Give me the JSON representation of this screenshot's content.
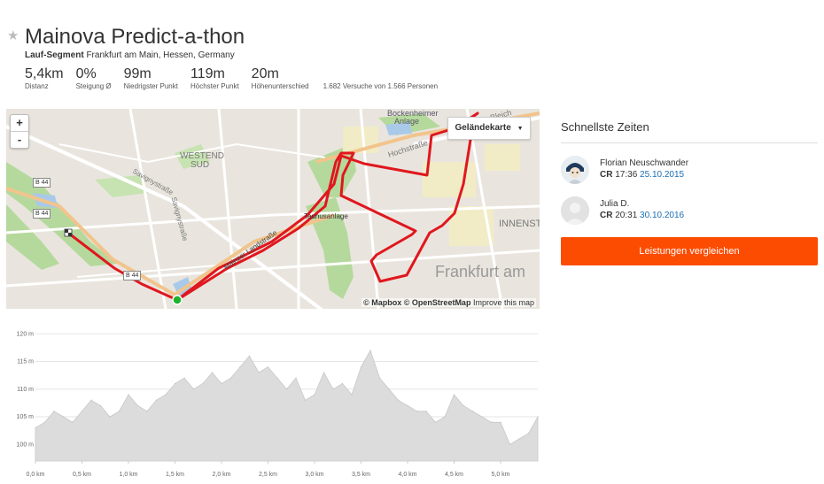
{
  "segment": {
    "title": "Mainova Predict-a-thon",
    "type_label": "Lauf-Segment",
    "location": "Frankfurt am Main, Hessen, Germany",
    "stats": [
      {
        "value": "5,4km",
        "label": "Distanz"
      },
      {
        "value": "0%",
        "label": "Steigung Ø"
      },
      {
        "value": "99m",
        "label": "Niedrigster Punkt"
      },
      {
        "value": "119m",
        "label": "Höchster Punkt"
      },
      {
        "value": "20m",
        "label": "Höhenunterschied"
      }
    ],
    "attempts": "1.682 Versuche von 1.566 Personen"
  },
  "map": {
    "zoom_in": "+",
    "zoom_out": "-",
    "map_type": "Geländekarte",
    "attribution_mapbox": "© Mapbox",
    "attribution_osm": "© OpenStreetMap",
    "attribution_improve": "Improve this map",
    "labels": {
      "westend": "WESTEND",
      "sud": "SUD",
      "bockenheimer": "Bockenheimer",
      "anlage": "Anlage",
      "hochstrasse": "Hochstraße",
      "savigny1": "Savignystraße",
      "savigny2": "Savignystraße",
      "mainzer": "Mainzer Landstraße",
      "taunusanlage": "Taunusanlage",
      "innenst": "INNENST",
      "frankfurt": "Frankfurt am",
      "bleich": "Bleich",
      "b44a": "B 44",
      "b44b": "B 44",
      "b44c": "B 44"
    },
    "colors": {
      "route": "#e0171e",
      "start": "#1db32c"
    }
  },
  "sidebar": {
    "title": "Schnellste Zeiten",
    "entries": [
      {
        "name": "Florian Neuschwander",
        "badge": "CR",
        "time": "17:36",
        "date": "25.10.2015"
      },
      {
        "name": "Julia D.",
        "badge": "CR",
        "time": "20:31",
        "date": "30.10.2016"
      }
    ],
    "compare_button": "Leistungen vergleichen",
    "colors": {
      "accent": "#fc4c02",
      "link": "#1a6fb5"
    }
  },
  "chart_data": {
    "type": "area",
    "x_unit": "km",
    "y_unit": "m",
    "ylim": [
      97,
      121
    ],
    "xlim": [
      0,
      5.4
    ],
    "y_ticks": [
      "100 m",
      "105 m",
      "110 m",
      "115 m",
      "120 m"
    ],
    "y_tick_values": [
      100,
      105,
      110,
      115,
      120
    ],
    "x_ticks": [
      "0,0 km",
      "0,5 km",
      "1,0 km",
      "1,5 km",
      "2,0 km",
      "2,5 km",
      "3,0 km",
      "3,5 km",
      "4,0 km",
      "4,5 km",
      "5,0 km"
    ],
    "x_tick_values": [
      0,
      0.5,
      1.0,
      1.5,
      2.0,
      2.5,
      3.0,
      3.5,
      4.0,
      4.5,
      5.0
    ],
    "grid": true,
    "x": [
      0.0,
      0.1,
      0.2,
      0.3,
      0.4,
      0.5,
      0.6,
      0.7,
      0.8,
      0.9,
      1.0,
      1.1,
      1.2,
      1.3,
      1.4,
      1.5,
      1.6,
      1.7,
      1.8,
      1.9,
      2.0,
      2.1,
      2.2,
      2.3,
      2.4,
      2.5,
      2.6,
      2.7,
      2.8,
      2.9,
      3.0,
      3.1,
      3.2,
      3.3,
      3.4,
      3.5,
      3.6,
      3.7,
      3.8,
      3.9,
      4.0,
      4.1,
      4.2,
      4.3,
      4.4,
      4.5,
      4.6,
      4.7,
      4.8,
      4.9,
      5.0,
      5.1,
      5.2,
      5.3,
      5.4
    ],
    "values": [
      103,
      104,
      106,
      105,
      104,
      106,
      108,
      107,
      105,
      106,
      109,
      107,
      106,
      108,
      109,
      111,
      112,
      110,
      111,
      113,
      111,
      112,
      114,
      116,
      113,
      114,
      112,
      110,
      112,
      108,
      109,
      113,
      110,
      111,
      109,
      114,
      117,
      112,
      110,
      108,
      107,
      106,
      106,
      104,
      105,
      109,
      107,
      106,
      105,
      104,
      104,
      100,
      101,
      102,
      105
    ]
  }
}
